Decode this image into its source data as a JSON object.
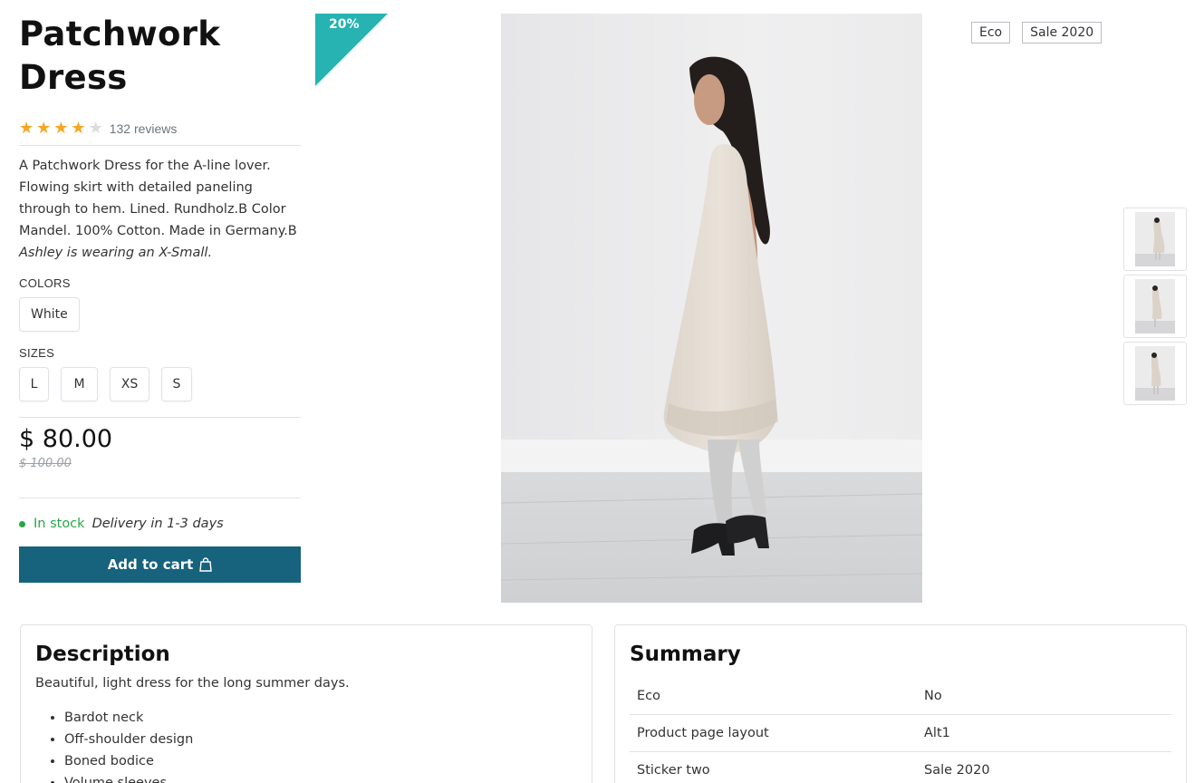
{
  "product": {
    "title": "Patchwork Dress",
    "rating": 4,
    "rating_max": 5,
    "reviews_label": "132 reviews",
    "description_parts": {
      "main": "A Patchwork Dress for the A-line lover. Flowing skirt with detailed paneling through to hem. Lined. Rundholz.B Color Mandel. 100% Cotton. Made in Germany.B ",
      "italic": "Ashley is wearing an X-Small."
    },
    "colors_label": "COLORS",
    "colors": [
      "White"
    ],
    "sizes_label": "SIZES",
    "sizes": [
      "L",
      "M",
      "XS",
      "S"
    ],
    "price": "$ 80.00",
    "old_price": "$ 100.00",
    "stock": "In stock",
    "delivery": "Delivery in 1-3 days",
    "add_to_cart": "Add to cart",
    "discount_badge": "20%"
  },
  "tags": [
    "Eco",
    "Sale 2020"
  ],
  "description_card": {
    "title": "Description",
    "intro": "Beautiful, light dress for the long summer days.",
    "bullets": [
      "Bardot neck",
      "Off-shoulder design",
      "Boned bodice",
      "Volume sleeves"
    ]
  },
  "summary_card": {
    "title": "Summary",
    "rows": [
      {
        "key": "Eco",
        "value": "No"
      },
      {
        "key": "Product page layout",
        "value": "Alt1"
      },
      {
        "key": "Sticker two",
        "value": "Sale 2020"
      }
    ]
  },
  "colors": {
    "accent": "#17627d",
    "ribbon": "#26b3b1",
    "stock": "#28a745",
    "star": "#f5a623"
  }
}
